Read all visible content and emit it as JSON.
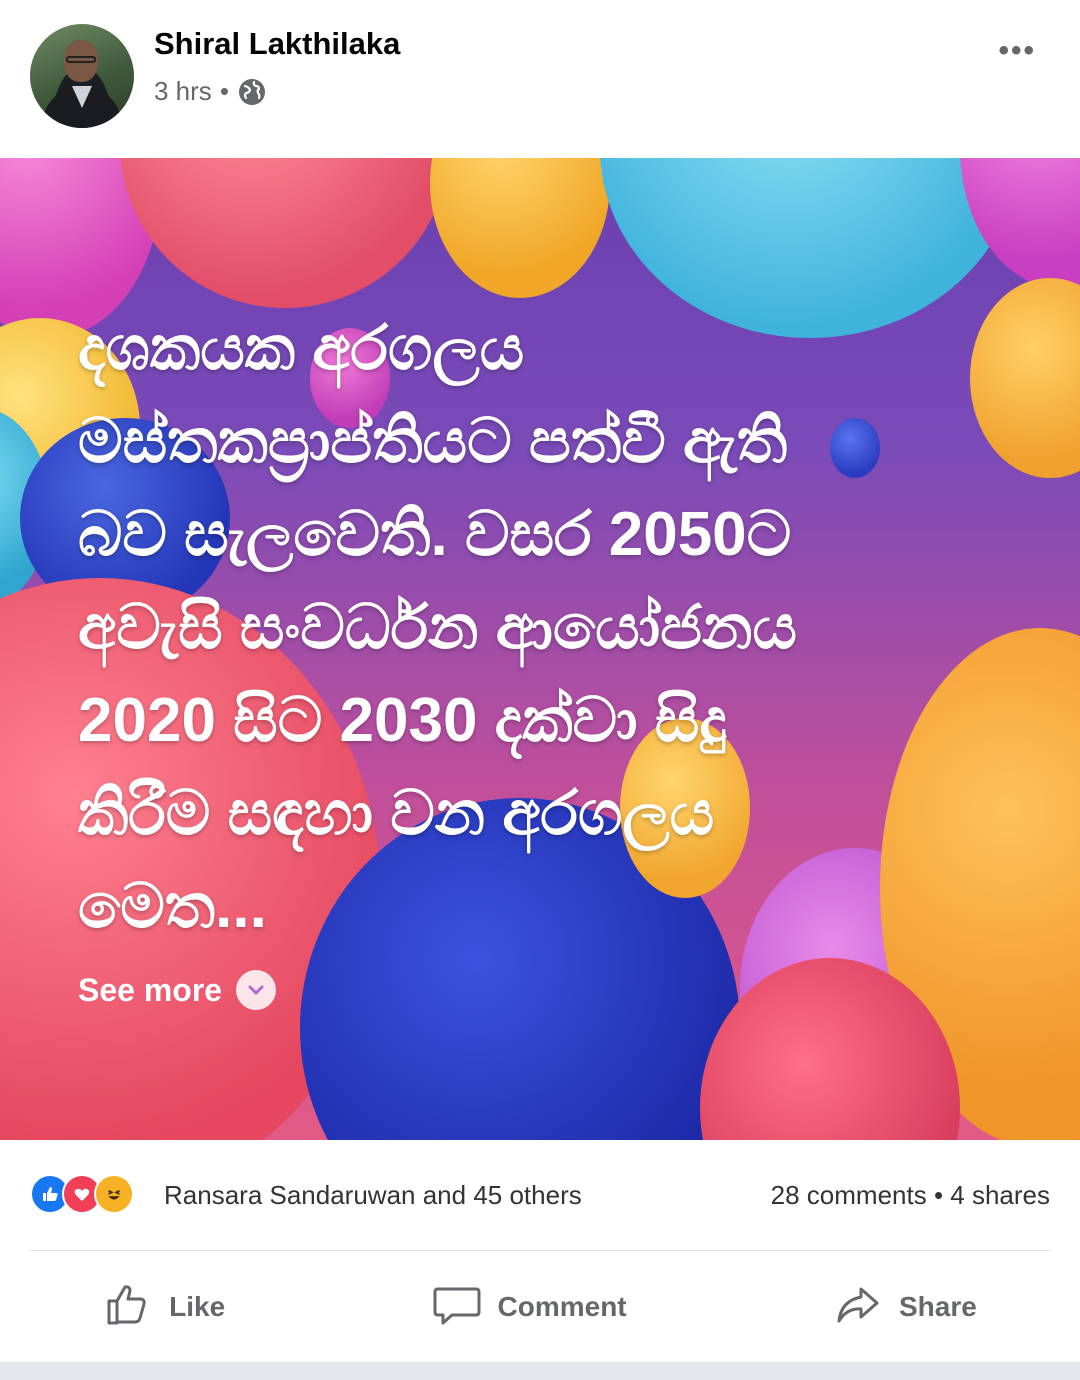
{
  "post": {
    "author": "Shiral Lakthilaka",
    "time": "3 hrs",
    "dot": "•",
    "privacy_icon": "globe-icon",
    "menu_icon": "more-icon",
    "menu_label": "•••",
    "text_lines": [
      "දශකයක අරගලය",
      "මස්තකප්‍රාප්තියට පත්වී ඇති",
      "බව සැලවෙති. වසර 2050ට",
      "අවැසි සංවර්ධන ආයෝජනය",
      "2020 සිට 2030 දක්වා සිදු",
      "කිරීම සඳහා වන අරගලය",
      "මෙත..."
    ],
    "see_more": "See more",
    "background_colors": [
      "#6a3fb0",
      "#c24f9a",
      "#e25a86"
    ]
  },
  "engagement": {
    "reaction_icons": [
      "like-icon",
      "love-icon",
      "haha-icon"
    ],
    "reactors": "Ransara Sandaruwan and 45 others",
    "counts": "28 comments • 4 shares"
  },
  "actions": {
    "like": "Like",
    "comment": "Comment",
    "share": "Share"
  },
  "colors": {
    "accent": "#1877f2",
    "secondary_text": "#65676b"
  }
}
